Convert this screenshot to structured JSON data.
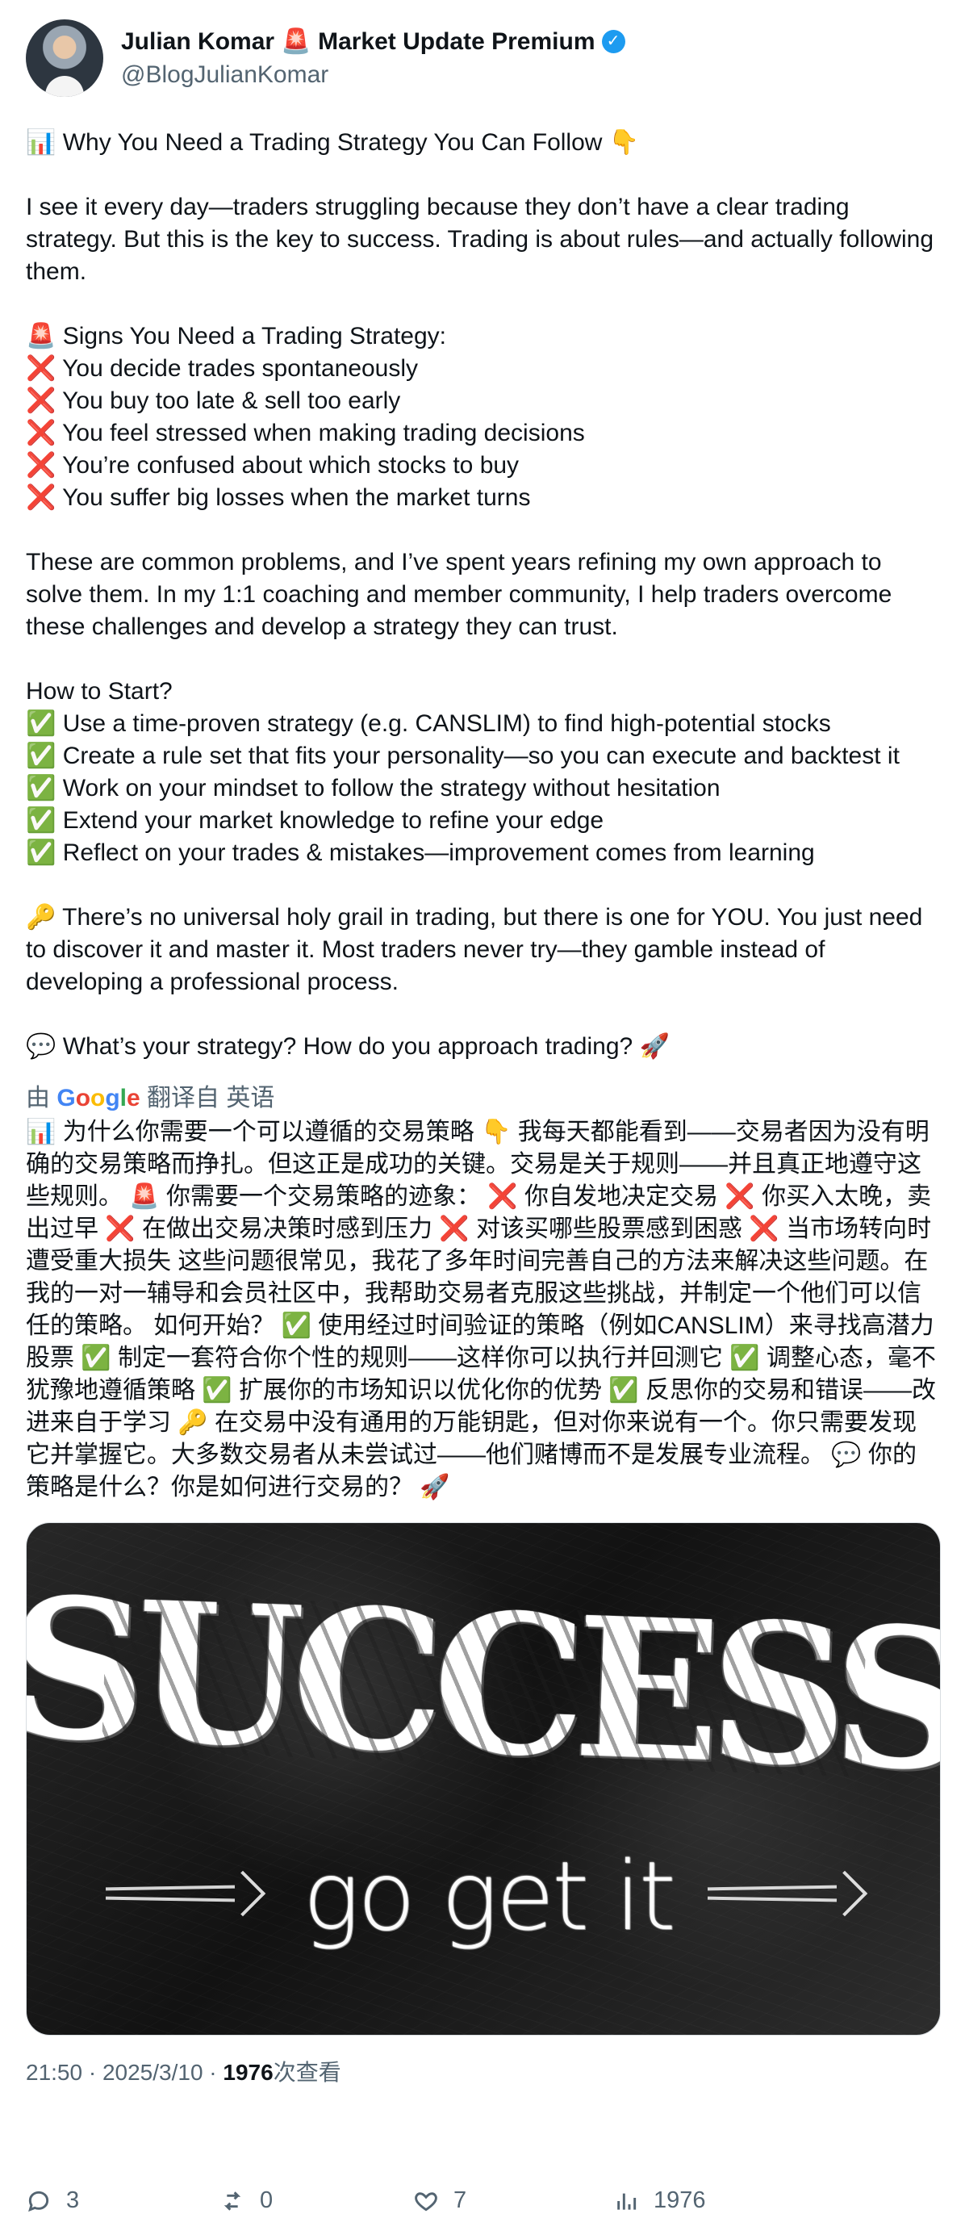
{
  "author": {
    "name": "Julian Komar 🚨 Market Update Premium",
    "handle": "@BlogJulianKomar",
    "verified_label": "✓"
  },
  "post": {
    "text": "📊 Why You Need a Trading Strategy You Can Follow 👇\n\nI see it every day—traders struggling because they don’t have a clear trading strategy. But this is the key to success. Trading is about rules—and actually following them.\n\n🚨 Signs You Need a Trading Strategy:\n❌ You decide trades spontaneously\n❌ You buy too late & sell too early\n❌ You feel stressed when making trading decisions\n❌ You’re confused about which stocks to buy\n❌ You suffer big losses when the market turns\n\nThese are common problems, and I’ve spent years refining my own approach to solve them. In my 1:1 coaching and member community, I help traders overcome these challenges and develop a strategy they can trust.\n\nHow to Start?\n✅ Use a time-proven strategy (e.g. CANSLIM) to find high-potential stocks\n✅ Create a rule set that fits your personality—so you can execute and backtest it\n✅ Work on your mindset to follow the strategy without hesitation\n✅ Extend your market knowledge to refine your edge\n✅ Reflect on your trades & mistakes—improvement comes from learning\n\n🔑 There’s no universal holy grail in trading, but there is one for YOU. You just need to discover it and master it. Most traders never try—they gamble instead of developing a professional process.\n\n💬 What’s your strategy? How do you approach trading? 🚀"
  },
  "translation": {
    "prefix": "由",
    "provider_letters": [
      "G",
      "o",
      "o",
      "g",
      "l",
      "e"
    ],
    "suffix": "翻译自 英语",
    "text": "📊 为什么你需要一个可以遵循的交易策略 👇 我每天都能看到——交易者因为没有明确的交易策略而挣扎。但这正是成功的关键。交易是关于规则——并且真正地遵守这些规则。 🚨 你需要一个交易策略的迹象： ❌ 你自发地决定交易 ❌ 你买入太晚，卖出过早 ❌ 在做出交易决策时感到压力 ❌ 对该买哪些股票感到困惑 ❌ 当市场转向时遭受重大损失 这些问题很常见，我花了多年时间完善自己的方法来解决这些问题。在我的一对一辅导和会员社区中，我帮助交易者克服这些挑战，并制定一个他们可以信任的策略。 如何开始？ ✅ 使用经过时间验证的策略（例如CANSLIM）来寻找高潜力股票 ✅ 制定一套符合你个性的规则——这样你可以执行并回测它 ✅ 调整心态，毫不犹豫地遵循策略 ✅ 扩展你的市场知识以优化你的优势 ✅ 反思你的交易和错误——改进来自于学习 🔑 在交易中没有通用的万能钥匙，但对你来说有一个。你只需要发现它并掌握它。大多数交易者从未尝试过——他们赌博而不是发展专业流程。 💬 你的策略是什么？你是如何进行交易的？ 🚀"
  },
  "image": {
    "main_text": "SUCCESS",
    "sub_text": "go get it"
  },
  "meta": {
    "time_date": "21:50 · 2025/3/10 · ",
    "views_number": "1976",
    "views_label": "次查看"
  },
  "actions": {
    "reply_count": "3",
    "repost_count": "0",
    "like_count": "7",
    "view_count": "1976"
  }
}
